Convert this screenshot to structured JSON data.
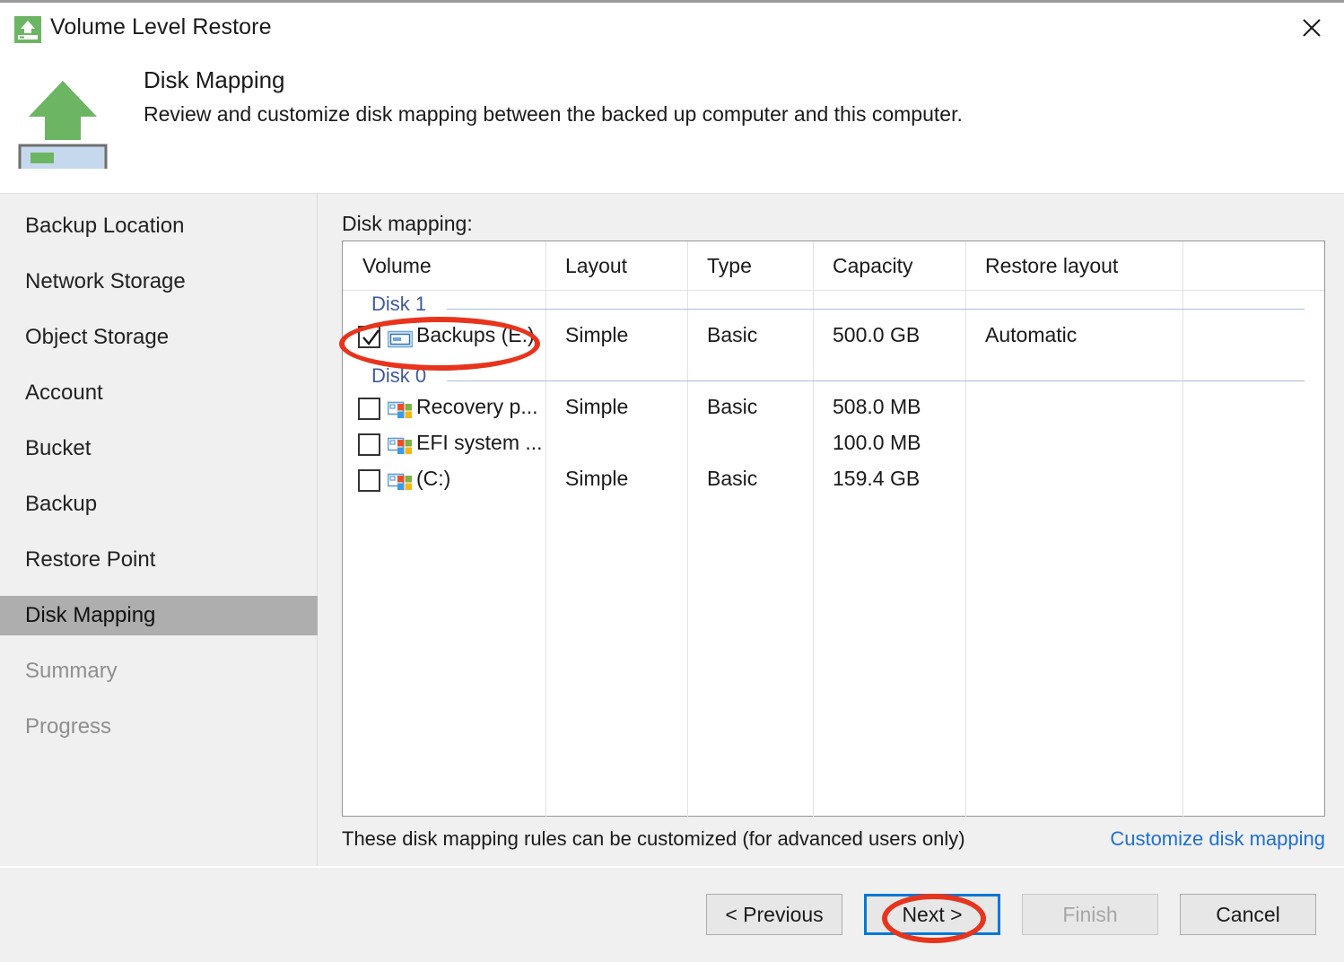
{
  "window": {
    "title": "Volume Level Restore",
    "icon": "restore-volume-icon",
    "close_label": "✕",
    "accent": "#0078d7",
    "annotation_color": "#e8341c"
  },
  "header": {
    "icon": "upload-to-volume-icon",
    "title": "Disk Mapping",
    "subtitle": "Review and customize disk mapping between the backed up computer and this computer."
  },
  "sidebar": {
    "items": [
      {
        "label": "Backup Location",
        "state": "normal"
      },
      {
        "label": "Network Storage",
        "state": "normal"
      },
      {
        "label": "Object Storage",
        "state": "normal"
      },
      {
        "label": "Account",
        "state": "normal"
      },
      {
        "label": "Bucket",
        "state": "normal"
      },
      {
        "label": "Backup",
        "state": "normal"
      },
      {
        "label": "Restore Point",
        "state": "normal"
      },
      {
        "label": "Disk Mapping",
        "state": "active"
      },
      {
        "label": "Summary",
        "state": "dim"
      },
      {
        "label": "Progress",
        "state": "dim"
      }
    ]
  },
  "main": {
    "section_label": "Disk mapping:",
    "columns": [
      "Volume",
      "Layout",
      "Type",
      "Capacity",
      "Restore layout",
      ""
    ],
    "groups": [
      {
        "name": "Disk 1",
        "rows": [
          {
            "volume": "Backups (E:)",
            "icon": "drive-icon",
            "checked": true,
            "layout": "Simple",
            "type": "Basic",
            "capacity": "500.0 GB",
            "restore_layout": "Automatic"
          }
        ]
      },
      {
        "name": "Disk 0",
        "rows": [
          {
            "volume": "Recovery p...",
            "icon": "windows-volume-icon",
            "checked": false,
            "layout": "Simple",
            "type": "Basic",
            "capacity": "508.0 MB",
            "restore_layout": ""
          },
          {
            "volume": "EFI system ...",
            "icon": "windows-volume-icon",
            "checked": false,
            "layout": "",
            "type": "",
            "capacity": "100.0 MB",
            "restore_layout": ""
          },
          {
            "volume": "(C:)",
            "icon": "windows-volume-icon",
            "checked": false,
            "layout": "Simple",
            "type": "Basic",
            "capacity": "159.4 GB",
            "restore_layout": ""
          }
        ]
      }
    ],
    "note": "These disk mapping rules can be customized (for advanced users only)",
    "link": "Customize disk mapping"
  },
  "footer": {
    "previous": "< Previous",
    "next": "Next >",
    "finish": "Finish",
    "cancel": "Cancel"
  }
}
